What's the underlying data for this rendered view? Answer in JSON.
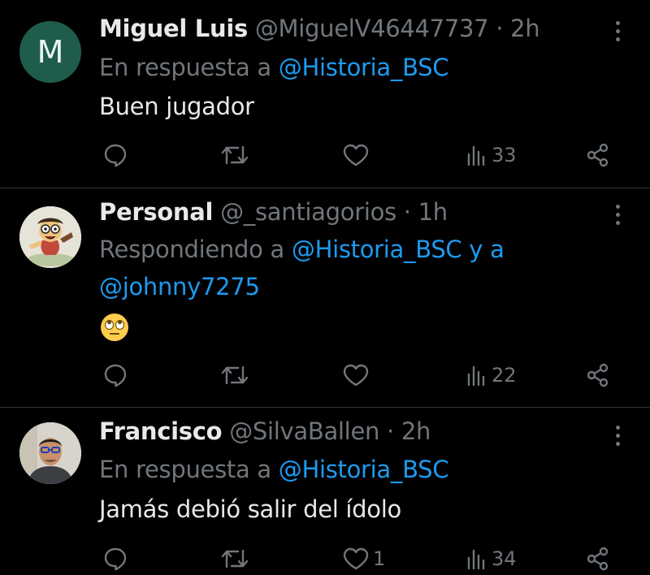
{
  "colors": {
    "background": "#000000",
    "text": "#e7e9ea",
    "muted": "#71767b",
    "link": "#1d9bf0",
    "divider": "#2f3336"
  },
  "tweets": [
    {
      "name": "Miguel Luis",
      "handle": "@MiguelV46447737",
      "separator": "·",
      "time": "2h",
      "avatar_letter": "M",
      "reply_prefix": "En respuesta a",
      "reply_mention": "@Historia_BSC",
      "text": "Buen jugador",
      "likes": "",
      "views": "33"
    },
    {
      "name": "Personal",
      "handle": "@_santiagorios",
      "separator": "·",
      "time": "1h",
      "avatar_icon": "cartoon-character-avatar",
      "reply_prefix": "Respondiendo a",
      "reply_mention": "@Historia_BSC",
      "reply_conj": "y a",
      "reply_mention2": "@johnny7275",
      "text": "🙄",
      "likes": "",
      "views": "22"
    },
    {
      "name": "Francisco",
      "handle": "@SilvaBallen",
      "separator": "·",
      "time": "2h",
      "avatar_icon": "person-photo-avatar",
      "reply_prefix": "En respuesta a",
      "reply_mention": "@Historia_BSC",
      "text": "Jamás debió salir del ídolo",
      "likes": "1",
      "views": "34"
    }
  ],
  "icons": {
    "reply": "reply-icon",
    "retweet": "retweet-icon",
    "like": "heart-icon",
    "views": "views-icon",
    "share": "share-icon",
    "more": "more-options-icon"
  }
}
